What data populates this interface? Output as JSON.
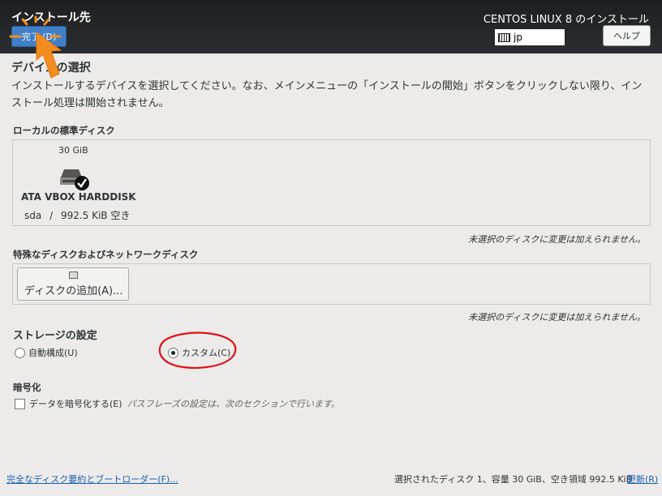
{
  "header": {
    "title": "インストール先",
    "done_label": "完了 (D)",
    "product": "CENTOS LINUX 8 のインストール",
    "keyboard_layout": "jp",
    "help_label": "ヘルプ"
  },
  "devices": {
    "heading": "デバイスの選択",
    "description": "インストールするデバイスを選択してください。なお、メインメニューの「インストールの開始」ボタンをクリックしない限り、インストール処理は開始されません。"
  },
  "local_disks": {
    "label": "ローカルの標準ディスク",
    "disk": {
      "size": "30 GiB",
      "name": "ATA VBOX HARDDISK",
      "device": "sda",
      "separator": "/",
      "free": "992.5 KiB 空き",
      "selected": true
    },
    "note": "未選択のディスクに変更は加えられません。"
  },
  "special_disks": {
    "label": "特殊なディスクおよびネットワークディスク",
    "add_button": "ディスクの追加(A)...",
    "note": "未選択のディスクに変更は加えられません。"
  },
  "storage": {
    "heading": "ストレージの設定",
    "auto_label": "自動構成(U)",
    "custom_label": "カスタム(C)",
    "selected": "custom"
  },
  "encryption": {
    "heading": "暗号化",
    "checkbox_label": "データを暗号化する(E)",
    "hint": "パスフレーズの設定は、次のセクションで行います。",
    "checked": false
  },
  "footer": {
    "summary_link": "完全なディスク要約とブートローダー(F)...",
    "status": "選択されたディスク 1、容量 30 GiB、空き領域 992.5 KiB",
    "refresh_label": "更新(R)"
  },
  "colors": {
    "header_bg": "#1d1f21",
    "done_button": "#3f80c8",
    "annotation_arrow": "#f28c1e",
    "annotation_circle": "#e0111a",
    "link": "#1a5fb4"
  }
}
